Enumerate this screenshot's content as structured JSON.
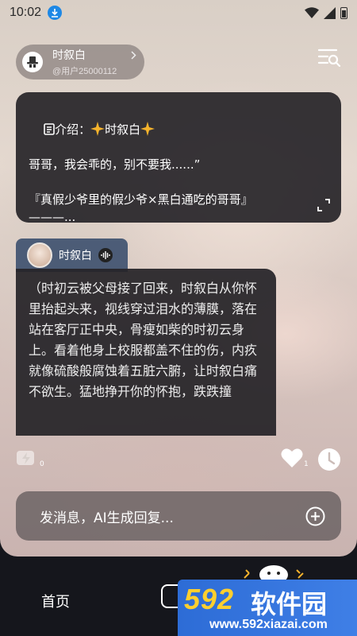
{
  "status_bar": {
    "time": "10:02"
  },
  "profile": {
    "name": "时叙白",
    "user_id": "@用户25000112"
  },
  "intro": {
    "label": "介绍：",
    "name": "时叙白",
    "line1": "哥哥，我会乖的，别不要我......”",
    "line2": "『真假少爷里的假少爷×黑白通吃的哥哥』",
    "line3": "———..."
  },
  "speaker": {
    "name": "时叙白"
  },
  "message": {
    "text": "（时初云被父母接了回来，时叙白从你怀里抬起头来，视线穿过泪水的薄膜，落在站在客厅正中央，骨瘦如柴的时初云身上。看着他身上校服都盖不住的伤，内疚就像硫酸般腐蚀着五脏六腑，让时叙白痛不欲生。猛地挣开你的怀抱，跌跌撞"
  },
  "actions": {
    "regenerate_count": "0",
    "like_count": "1"
  },
  "input": {
    "placeholder": "发消息，AI生成回复..."
  },
  "bottom_nav": {
    "home_label": "首页"
  },
  "watermark": {
    "logo": "592",
    "name": "软件园",
    "url": "www.592xiazai.com"
  },
  "colors": {
    "accent_blue": "#1e88e5",
    "watermark_yellow": "#ffcf2e",
    "watermark_blue": "#2d6cd6"
  }
}
